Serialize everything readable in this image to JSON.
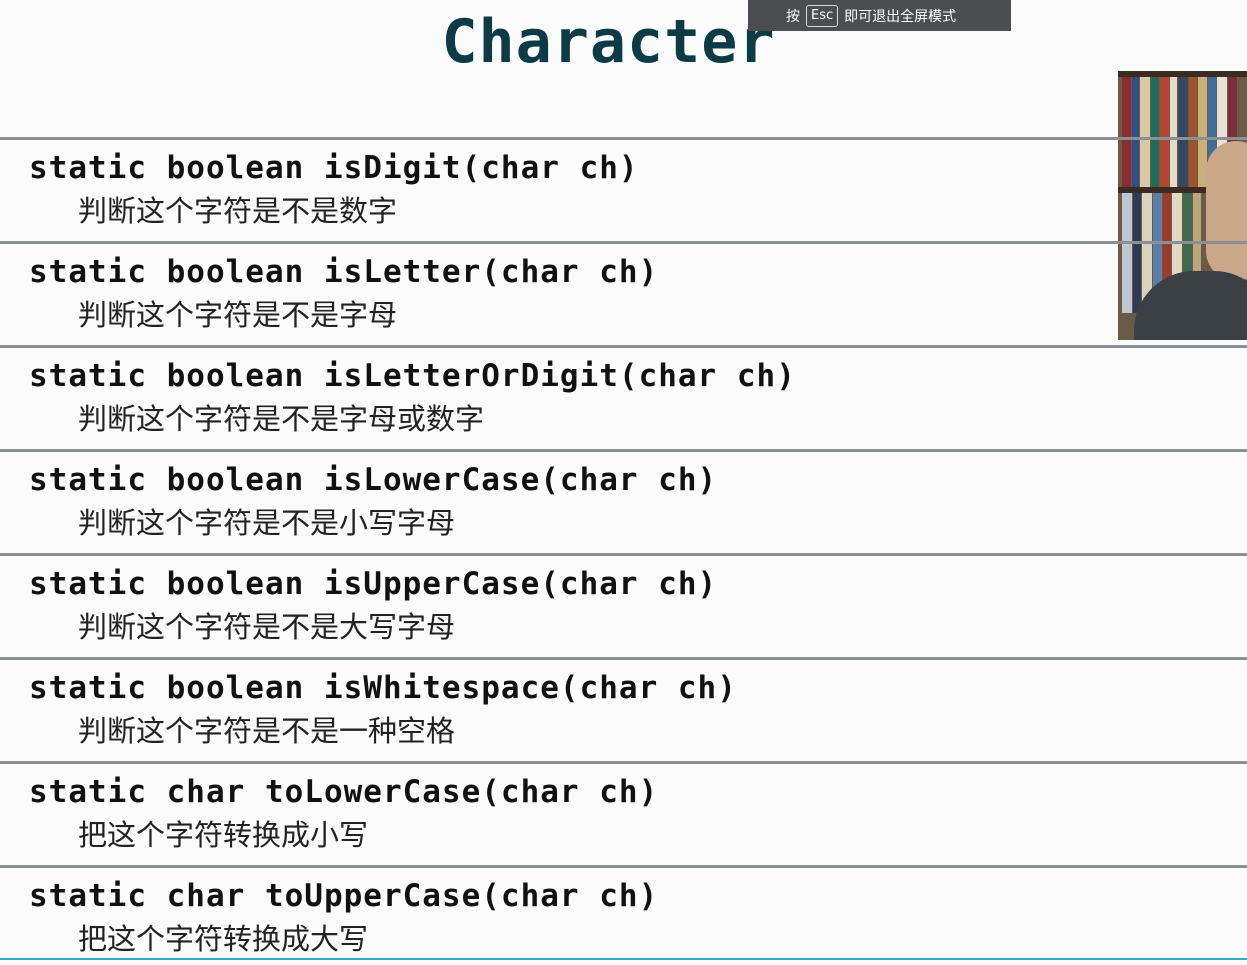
{
  "slide": {
    "title": "Character"
  },
  "fullscreen_hint": {
    "prefix": "按",
    "key": "Esc",
    "suffix": "即可退出全屏模式"
  },
  "methods": [
    {
      "signature": "static boolean isDigit(char ch)",
      "description": "判断这个字符是不是数字"
    },
    {
      "signature": "static boolean isLetter(char ch)",
      "description": "判断这个字符是不是字母"
    },
    {
      "signature": "static boolean isLetterOrDigit(char ch)",
      "description": "判断这个字符是不是字母或数字"
    },
    {
      "signature": "static boolean isLowerCase(char ch)",
      "description": "判断这个字符是不是小写字母"
    },
    {
      "signature": "static boolean isUpperCase(char ch)",
      "description": "判断这个字符是不是大写字母"
    },
    {
      "signature": "static boolean isWhitespace(char ch)",
      "description": "判断这个字符是不是一种空格"
    },
    {
      "signature": "static char toLowerCase(char ch)",
      "description": "把这个字符转换成小写"
    },
    {
      "signature": "static char toUpperCase(char ch)",
      "description": "把这个字符转换成大写"
    }
  ]
}
